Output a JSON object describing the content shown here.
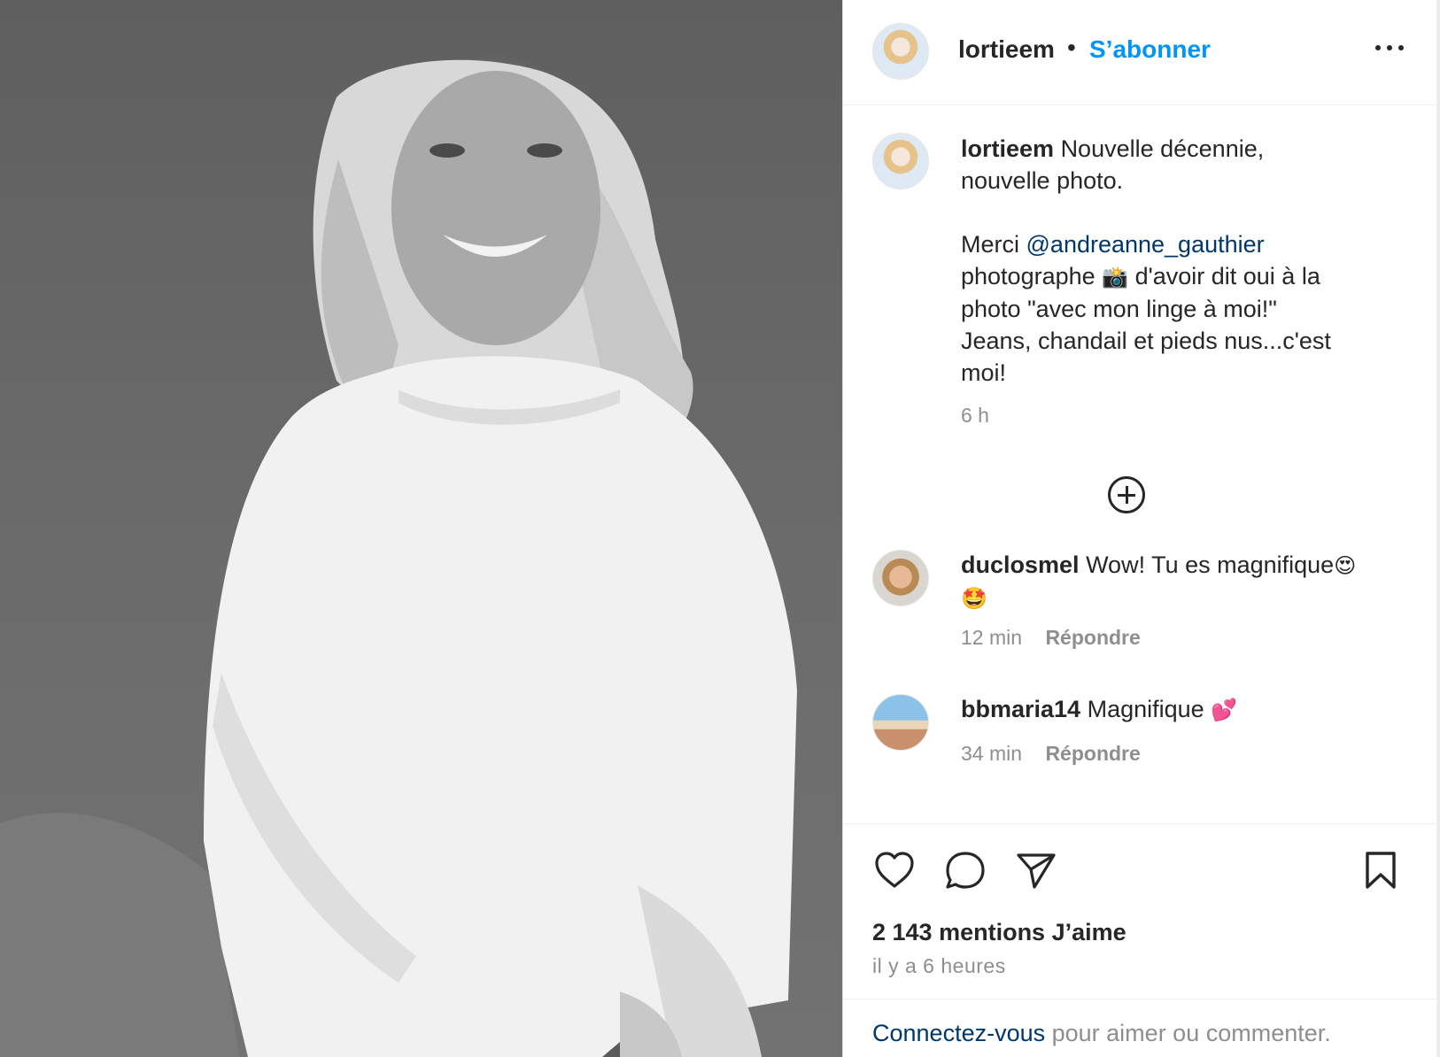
{
  "post": {
    "username": "lortieem",
    "separator": "•",
    "follow_label": "S’abonner",
    "more_label": "•••",
    "caption": {
      "username": "lortieem",
      "line1": "Nouvelle décennie,",
      "line2": "nouvelle photo.",
      "merci": "Merci",
      "mention": "@andreanne_gauthier",
      "line4a": "photographe",
      "camera_emoji": "📸",
      "line4b": "d'avoir dit oui à la",
      "line5": "photo \"avec mon linge à moi!\"",
      "line6": "Jeans, chandail et pieds nus...c'est",
      "line7": "moi!",
      "time": "6 h"
    },
    "comments": [
      {
        "username": "duclosmel",
        "text": "Wow! Tu es magnifique",
        "emoji1": "😍",
        "emoji2": "🤩",
        "time": "12 min",
        "reply": "Répondre"
      },
      {
        "username": "bbmaria14",
        "text": "Magnifique",
        "emoji1": "💕",
        "time": "34 min",
        "reply": "Répondre"
      }
    ],
    "likes": "2 143 mentions J’aime",
    "posted_ago": "il y a 6 heures",
    "login_prompt": {
      "link": "Connectez-vous",
      "text": "pour aimer ou commenter."
    },
    "icons": {
      "more": "more-options-icon",
      "add_comment": "plus-circle-icon",
      "like": "heart-icon",
      "comment": "comment-bubble-icon",
      "share": "paper-plane-icon",
      "save": "bookmark-icon"
    },
    "colors": {
      "follow": "#0095f6",
      "mention": "#00376b",
      "muted": "#8e8e8e",
      "text": "#262626"
    }
  }
}
